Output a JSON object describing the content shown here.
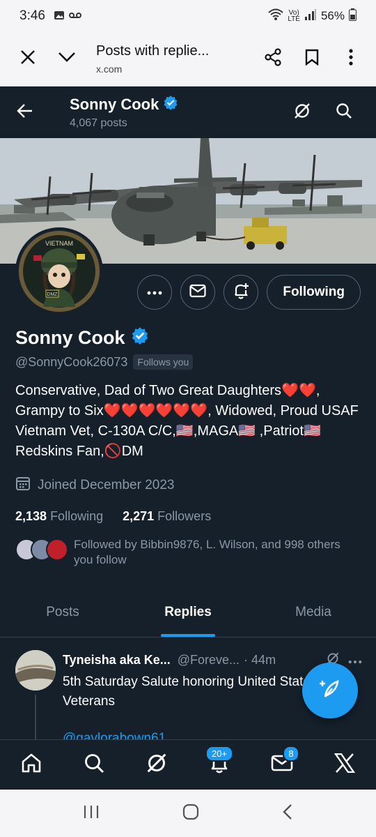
{
  "status_bar": {
    "time": "3:46",
    "net_label_top": "Vo)",
    "net_label_bottom": "LTE",
    "battery": "56%"
  },
  "browser": {
    "title": "Posts with replie...",
    "url": "x.com"
  },
  "header": {
    "name": "Sonny Cook",
    "posts": "4,067 posts"
  },
  "profile": {
    "name": "Sonny Cook",
    "handle": "@SonnyCook26073",
    "follows_you": "Follows you",
    "bio": "Conservative, Dad of Two Great Daughters❤️❤️, Grampy to Six❤️❤️❤️❤️❤️❤️, Widowed, Proud USAF Vietnam Vet, C-130A C/C,🇺🇸,MAGA🇺🇸 ,Patriot🇺🇸Redskins Fan,🚫DM",
    "joined": "Joined December 2023",
    "following_count": "2,138",
    "following_label": "Following",
    "followers_count": "2,271",
    "followers_label": "Followers",
    "followed_by": "Followed by Bibbin9876, L. Wilson, and 998 others you follow",
    "follow_button": "Following",
    "avatar_text_top": "VIETNAM",
    "avatar_text_mid": "DMZ"
  },
  "tabs": [
    {
      "label": "Posts",
      "active": false
    },
    {
      "label": "Replies",
      "active": true
    },
    {
      "label": "Media",
      "active": false
    }
  ],
  "tweet": {
    "name": "Tyneisha aka Ke...",
    "handle": "@Foreve...",
    "time": "· 44m",
    "text": "5th Saturday Salute honoring United States Veterans",
    "link": "@gaylorabown61"
  },
  "bottom_nav": {
    "notifications_badge": "20+",
    "messages_badge": "8"
  },
  "colors": {
    "accent": "#1d9bf0",
    "background": "#15202b",
    "muted": "#8b98a5"
  }
}
